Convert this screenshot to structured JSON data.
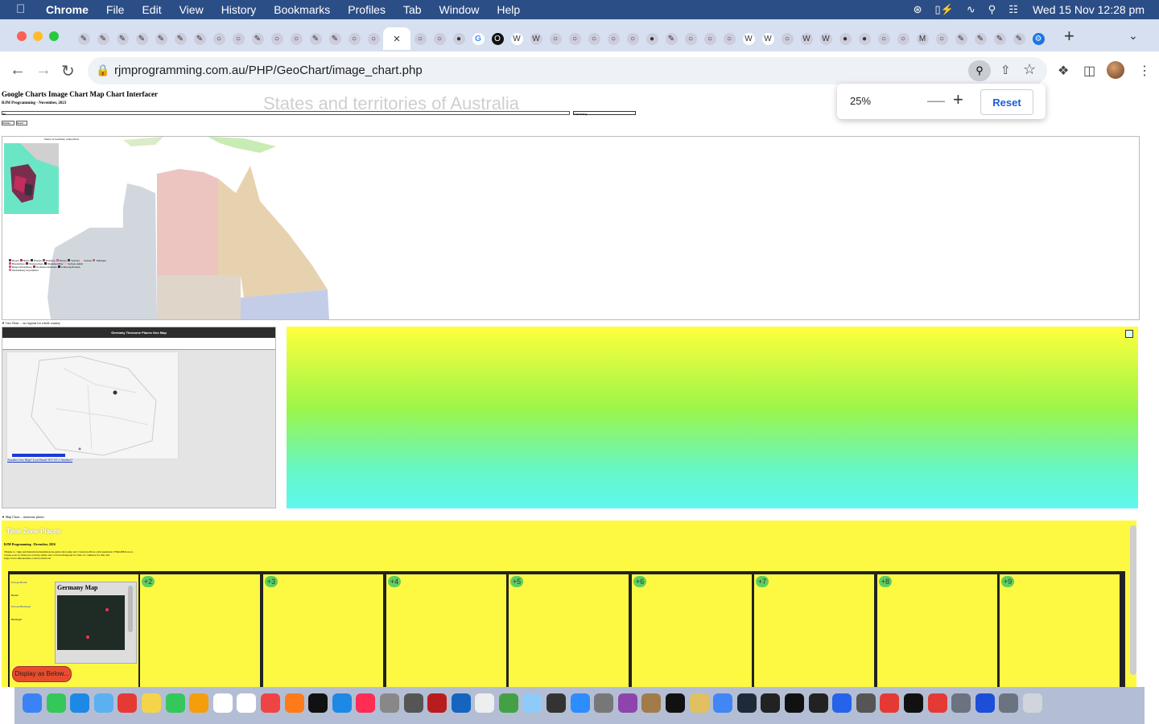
{
  "menubar": {
    "app": "Chrome",
    "items": [
      "File",
      "Edit",
      "View",
      "History",
      "Bookmarks",
      "Profiles",
      "Tab",
      "Window",
      "Help"
    ],
    "clock": "Wed 15 Nov  12:28 pm"
  },
  "browser": {
    "url": "rjmprogramming.com.au/PHP/GeoChart/image_chart.php",
    "active_tab_close": "×",
    "new_tab": "+"
  },
  "zoom": {
    "level": "25%",
    "minus": "—",
    "plus": "+",
    "reset_label": "Reset"
  },
  "page": {
    "title": "Google Charts Image Chart Map Chart Interfacer",
    "subtitle": "RJM Programming - November, 2023",
    "chart_title": "States and territories of Australia",
    "text_value": "all",
    "select_value": "Germany",
    "btn1": "Display",
    "btn2": "Reset",
    "germany_caption": "States of Germany related lists",
    "section1_label": "▼    Geo Chart ... no regions for whole country",
    "geo_header": "Germany Timezone Places Geo Map",
    "geo_links": "Another Geo Map?   Lost   Email   WT   ST   ≡   Another?",
    "section2_label": "▼    Map Chart ... timezone places",
    "tz_logo": "Time Zone Places",
    "tz_subtitle": "RJM Programming - December, 2016",
    "tz_thanks": "Thanks to //php.net/manual/en/datetimezone.getlocation.php and //stackoverflow.com/questions/17842268/how-to-create-a-utc-2-charts-in-country-name and //www.latlong.net for lists of countries for this and http://www.timeanddate.com/worldclock/",
    "germany_map_title": "Germany Map",
    "display_button": "Display as Below...",
    "offsets": [
      "+2",
      "+3",
      "+4",
      "+5",
      "+6",
      "+7",
      "+8",
      "+9"
    ],
    "legend": [
      "Bayern",
      "Berlin",
      "Bremen",
      "Hamburg",
      "Hessen",
      "Saarland",
      "Sachsen",
      "Thüringen",
      "Brandenburg",
      "Niedersachsen",
      "Rheinland-Pfalz",
      "Sachsen-Anhalt",
      "Baden-Württemberg",
      "Nordrhein-Westfalen",
      "Schleswig-Holstein",
      "Mecklenburg-Vorpommern"
    ],
    "small_labels": [
      "Europe/Berlin",
      "Berlin",
      "Europe/Busingen",
      "Busingen"
    ]
  },
  "colors": {
    "wa": "#d2d7de",
    "nt": "#ecc4c0",
    "qld": "#e7d2b0",
    "sa": "#dfd5c8",
    "nsw": "#c4cde8",
    "png": "#c9ebb4"
  },
  "dock": [
    "finder",
    "messages",
    "safari",
    "mail",
    "opera",
    "notes",
    "facetime",
    "photos",
    "calendar",
    "reminders",
    "news",
    "firefox",
    "tv",
    "app-store",
    "music",
    "launchpad",
    "calculator",
    "filezilla",
    "xcode",
    "textedit",
    "maps",
    "preview",
    "bbedit",
    "zoom",
    "system",
    "podcasts",
    "folder",
    "intellij",
    "photos2",
    "chrome",
    "proxyman",
    "inkscape",
    "terminal",
    "terminal2",
    "cmake",
    "gimp",
    "opera2",
    "terminal3",
    "opera3",
    "finder2",
    "globe",
    "downloads",
    "trash"
  ]
}
